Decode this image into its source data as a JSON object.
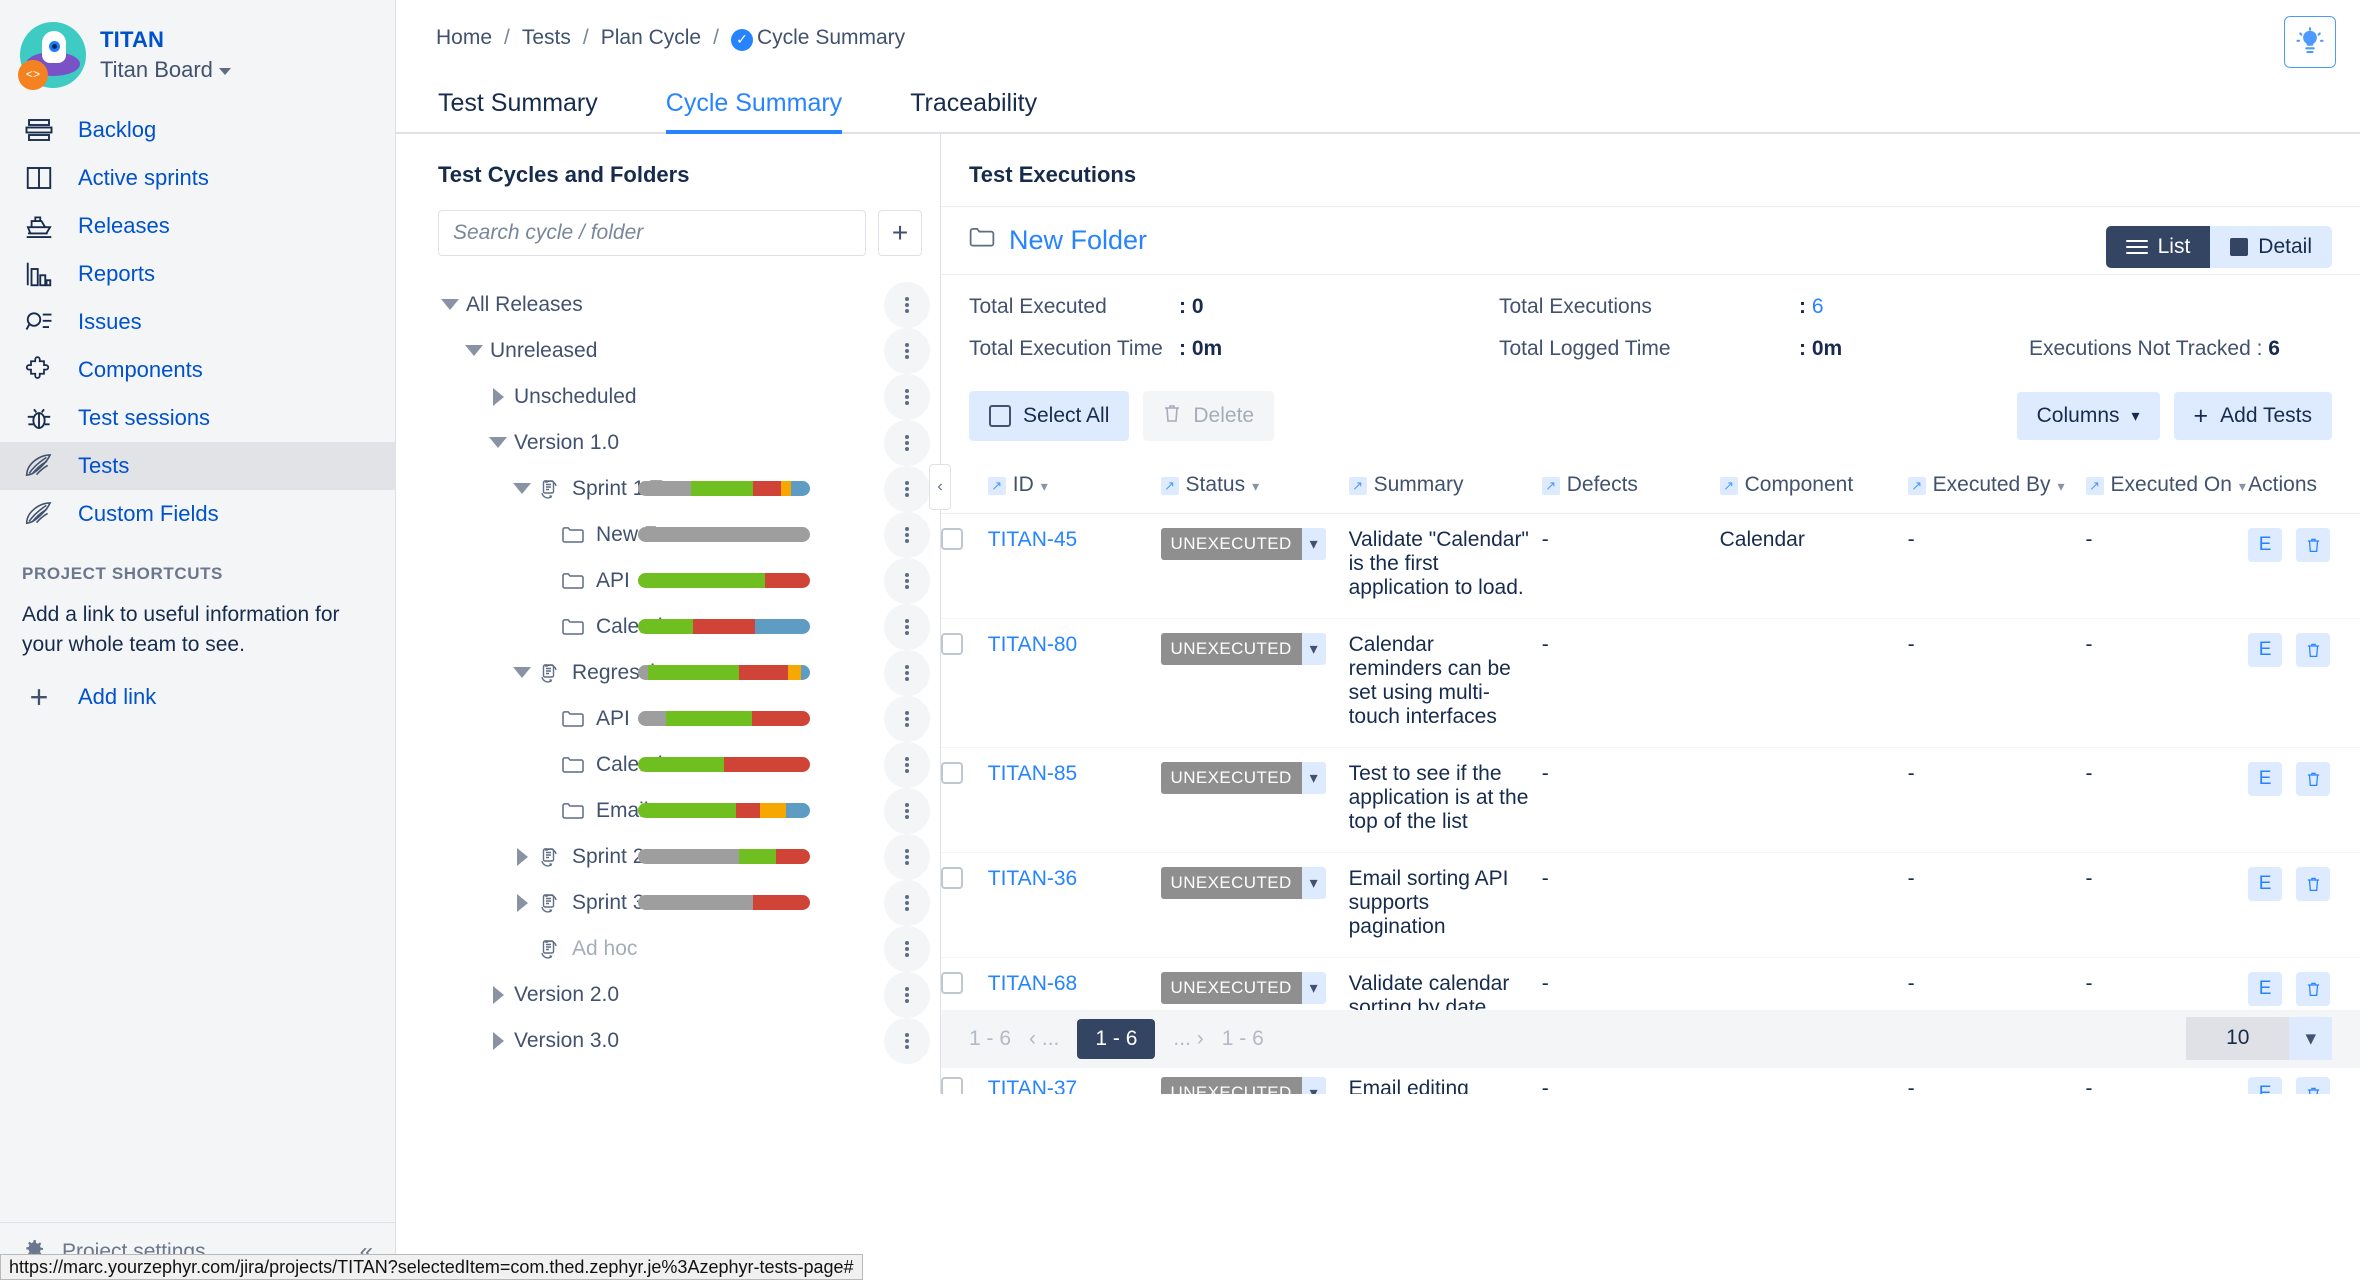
{
  "project": {
    "name": "TITAN",
    "board": "Titan Board",
    "avatar_badge": "<>"
  },
  "sidebar": {
    "items": [
      {
        "label": "Backlog",
        "icon": "backlog-icon"
      },
      {
        "label": "Active sprints",
        "icon": "board-icon"
      },
      {
        "label": "Releases",
        "icon": "ship-icon"
      },
      {
        "label": "Reports",
        "icon": "chart-icon"
      },
      {
        "label": "Issues",
        "icon": "search-list-icon"
      },
      {
        "label": "Components",
        "icon": "puzzle-icon"
      },
      {
        "label": "Test sessions",
        "icon": "bug-icon"
      },
      {
        "label": "Tests",
        "icon": "feather-icon"
      },
      {
        "label": "Custom Fields",
        "icon": "feather-icon"
      }
    ],
    "active_item": "Tests",
    "shortcuts_heading": "PROJECT SHORTCUTS",
    "shortcuts_text": "Add a link to useful information for your whole team to see.",
    "add_link_label": "Add link",
    "project_settings_label": "Project settings"
  },
  "breadcrumb": {
    "items": [
      "Home",
      "Tests",
      "Plan Cycle"
    ],
    "current": "Cycle Summary",
    "separator": "/"
  },
  "tabs": [
    {
      "label": "Test Summary",
      "active": false
    },
    {
      "label": "Cycle Summary",
      "active": true
    },
    {
      "label": "Traceability",
      "active": false
    }
  ],
  "tree_panel": {
    "title": "Test Cycles and Folders",
    "search_placeholder": "Search cycle / folder",
    "search_value": "",
    "add_button": "+",
    "nodes": [
      {
        "label": "All Releases",
        "indent": 0,
        "state": "open",
        "icon": "none",
        "bar": []
      },
      {
        "label": "Unreleased",
        "indent": 1,
        "state": "open",
        "icon": "none",
        "bar": []
      },
      {
        "label": "Unscheduled",
        "indent": 2,
        "state": "closed",
        "icon": "none",
        "bar": []
      },
      {
        "label": "Version 1.0",
        "indent": 2,
        "state": "open",
        "icon": "none",
        "bar": []
      },
      {
        "label": "Sprint 1 Tes...",
        "indent": 3,
        "state": "open",
        "icon": "cycle-icon",
        "bar": [
          {
            "c": "#9E9E9E",
            "p": 31
          },
          {
            "c": "#6FBF20",
            "p": 36
          },
          {
            "c": "#D04437",
            "p": 16
          },
          {
            "c": "#F6A700",
            "p": 6
          },
          {
            "c": "#5E9CC4",
            "p": 11
          }
        ]
      },
      {
        "label": "New Fo...",
        "indent": 4,
        "state": "leaf",
        "icon": "folder-icon",
        "bar": [
          {
            "c": "#9E9E9E",
            "p": 100
          }
        ]
      },
      {
        "label": "API",
        "indent": 4,
        "state": "leaf",
        "icon": "folder-icon",
        "bar": [
          {
            "c": "#6FBF20",
            "p": 74
          },
          {
            "c": "#D04437",
            "p": 26
          }
        ]
      },
      {
        "label": "Calendar",
        "indent": 4,
        "state": "leaf",
        "icon": "folder-icon",
        "bar": [
          {
            "c": "#6FBF20",
            "p": 32
          },
          {
            "c": "#D04437",
            "p": 36
          },
          {
            "c": "#5E9CC4",
            "p": 32
          }
        ]
      },
      {
        "label": "Regression ...",
        "indent": 3,
        "state": "open",
        "icon": "cycle-icon",
        "bar": [
          {
            "c": "#9E9E9E",
            "p": 6
          },
          {
            "c": "#6FBF20",
            "p": 53
          },
          {
            "c": "#D04437",
            "p": 28
          },
          {
            "c": "#F6A700",
            "p": 8
          },
          {
            "c": "#5E9CC4",
            "p": 5
          }
        ]
      },
      {
        "label": "API",
        "indent": 4,
        "state": "leaf",
        "icon": "folder-icon",
        "bar": [
          {
            "c": "#9E9E9E",
            "p": 16
          },
          {
            "c": "#6FBF20",
            "p": 50
          },
          {
            "c": "#D04437",
            "p": 34
          }
        ]
      },
      {
        "label": "Calendar",
        "indent": 4,
        "state": "leaf",
        "icon": "folder-icon",
        "bar": [
          {
            "c": "#6FBF20",
            "p": 50
          },
          {
            "c": "#D04437",
            "p": 50
          }
        ]
      },
      {
        "label": "Email",
        "indent": 4,
        "state": "leaf",
        "icon": "folder-icon",
        "bar": [
          {
            "c": "#6FBF20",
            "p": 57
          },
          {
            "c": "#D04437",
            "p": 14
          },
          {
            "c": "#F6A700",
            "p": 15
          },
          {
            "c": "#5E9CC4",
            "p": 14
          }
        ]
      },
      {
        "label": "Sprint 2",
        "indent": 3,
        "state": "closed",
        "icon": "cycle-icon",
        "bar": [
          {
            "c": "#9E9E9E",
            "p": 59
          },
          {
            "c": "#6FBF20",
            "p": 21
          },
          {
            "c": "#D04437",
            "p": 20
          }
        ]
      },
      {
        "label": "Sprint 3",
        "indent": 3,
        "state": "closed",
        "icon": "cycle-icon",
        "bar": [
          {
            "c": "#9E9E9E",
            "p": 67
          },
          {
            "c": "#D04437",
            "p": 33
          }
        ]
      },
      {
        "label": "Ad hoc",
        "indent": 3,
        "state": "leaf",
        "icon": "cycle-icon",
        "muted": true,
        "bar": []
      },
      {
        "label": "Version 2.0",
        "indent": 2,
        "state": "closed",
        "icon": "none",
        "bar": []
      },
      {
        "label": "Version 3.0",
        "indent": 2,
        "state": "closed",
        "icon": "none",
        "bar": []
      }
    ]
  },
  "executions": {
    "title": "Test Executions",
    "folder_name": "New Folder",
    "view_list_label": "List",
    "view_detail_label": "Detail",
    "active_view": "List",
    "stats": [
      {
        "label": "Total Executed",
        "value": "0",
        "link": false
      },
      {
        "label": "Total Executions",
        "value": "6",
        "link": true
      },
      {
        "label": "Total Execution Time",
        "value": "0m",
        "link": false
      },
      {
        "label": "Total Logged Time",
        "value": "0m",
        "link": false
      },
      {
        "label": "Executions Not Tracked",
        "value": "6",
        "link": false
      }
    ],
    "toolbar": {
      "select_all": "Select All",
      "delete": "Delete",
      "columns": "Columns",
      "add_tests": "Add Tests"
    },
    "columns": [
      "ID",
      "Status",
      "Summary",
      "Defects",
      "Component",
      "Executed By",
      "Executed On",
      "Actions"
    ],
    "rows": [
      {
        "id": "TITAN-45",
        "status": "UNEXECUTED",
        "summary": "Validate \"Calendar\" is the first application to load.",
        "defects": "-",
        "component": "Calendar",
        "executed_by": "-",
        "executed_on": "-",
        "actions": [
          "E",
          "delete-icon"
        ]
      },
      {
        "id": "TITAN-80",
        "status": "UNEXECUTED",
        "summary": "Calendar reminders can be set using multi-touch interfaces",
        "defects": "-",
        "component": "",
        "executed_by": "-",
        "executed_on": "-",
        "actions": [
          "E",
          "delete-icon"
        ]
      },
      {
        "id": "TITAN-85",
        "status": "UNEXECUTED",
        "summary": "Test to see if the application is at the top of the list",
        "defects": "-",
        "component": "",
        "executed_by": "-",
        "executed_on": "-",
        "actions": [
          "E",
          "delete-icon"
        ]
      },
      {
        "id": "TITAN-36",
        "status": "UNEXECUTED",
        "summary": "Email sorting API supports pagination",
        "defects": "-",
        "component": "",
        "executed_by": "-",
        "executed_on": "-",
        "actions": [
          "E",
          "delete-icon"
        ]
      },
      {
        "id": "TITAN-68",
        "status": "UNEXECUTED",
        "summary": "Validate calendar sorting by date works",
        "defects": "-",
        "component": "",
        "executed_by": "-",
        "executed_on": "-",
        "actions": [
          "E",
          "delete-icon"
        ]
      },
      {
        "id": "TITAN-37",
        "status": "UNEXECUTED",
        "summary": "Email editing allows for text only formatting API",
        "defects": "-",
        "component": "",
        "executed_by": "-",
        "executed_on": "-",
        "actions": [
          "E",
          "delete-icon"
        ]
      }
    ],
    "pager": {
      "left_range": "1 - 6",
      "prev": "‹ ...",
      "current": "1 - 6",
      "next": "... ›",
      "right_range": "1 - 6",
      "page_size": "10"
    }
  },
  "status_bar": {
    "url": "https://marc.yourzephyr.com/jira/projects/TITAN?selectedItem=com.thed.zephyr.je%3Azephyr-tests-page#"
  },
  "colors": {
    "accent": "#2684FF",
    "link": "#0052CC",
    "sidebar_bg": "#F4F5F7",
    "status_gray": "#8F8F8F",
    "bar_pass": "#6FBF20",
    "bar_fail": "#D04437",
    "bar_wip": "#F6A700",
    "bar_blocked": "#5E9CC4",
    "bar_unexecuted": "#9E9E9E"
  }
}
